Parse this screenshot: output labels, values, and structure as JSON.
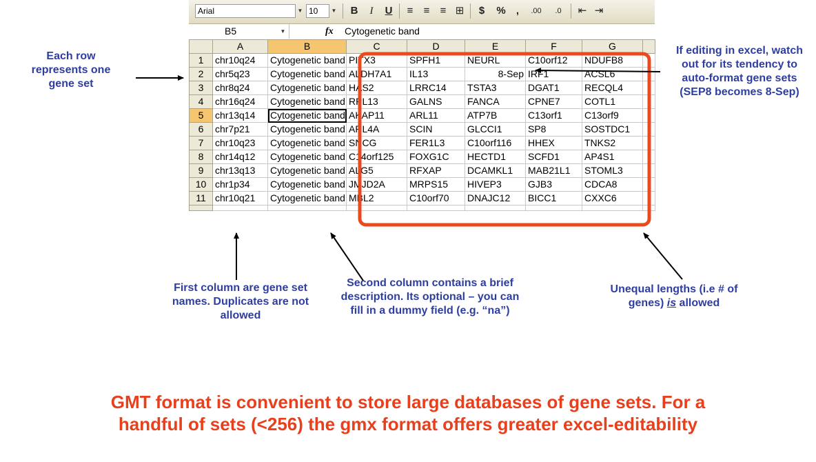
{
  "toolbar": {
    "font_name": "Arial",
    "font_size": "10",
    "bold": "B",
    "italic": "I",
    "underline": "U",
    "currency": "$",
    "percent": "%",
    "comma": ",",
    "inc_decimal": ".00",
    "dec_decimal": ".0"
  },
  "formula_bar": {
    "name_box": "B5",
    "fx": "fx",
    "content": "Cytogenetic band"
  },
  "grid": {
    "columns": [
      "A",
      "B",
      "C",
      "D",
      "E",
      "F",
      "G"
    ],
    "rows": [
      {
        "n": "1",
        "cells": [
          "chr10q24",
          "Cytogenetic band",
          "PITX3",
          "SPFH1",
          "NEURL",
          "C10orf12",
          "NDUFB8"
        ]
      },
      {
        "n": "2",
        "cells": [
          "chr5q23",
          "Cytogenetic band",
          "ALDH7A1",
          "IL13",
          "8-Sep",
          "IRF1",
          "ACSL6"
        ]
      },
      {
        "n": "3",
        "cells": [
          "chr8q24",
          "Cytogenetic band",
          "HAS2",
          "LRRC14",
          "TSTA3",
          "DGAT1",
          "RECQL4"
        ]
      },
      {
        "n": "4",
        "cells": [
          "chr16q24",
          "Cytogenetic band",
          "RPL13",
          "GALNS",
          "FANCA",
          "CPNE7",
          "COTL1"
        ]
      },
      {
        "n": "5",
        "cells": [
          "chr13q14",
          "Cytogenetic band",
          "AKAP11",
          "ARL11",
          "ATP7B",
          "C13orf1",
          "C13orf9"
        ]
      },
      {
        "n": "6",
        "cells": [
          "chr7p21",
          "Cytogenetic band",
          "ARL4A",
          "SCIN",
          "GLCCI1",
          "SP8",
          "SOSTDC1"
        ]
      },
      {
        "n": "7",
        "cells": [
          "chr10q23",
          "Cytogenetic band",
          "SNCG",
          "FER1L3",
          "C10orf116",
          "HHEX",
          "TNKS2"
        ]
      },
      {
        "n": "8",
        "cells": [
          "chr14q12",
          "Cytogenetic band",
          "C14orf125",
          "FOXG1C",
          "HECTD1",
          "SCFD1",
          "AP4S1"
        ]
      },
      {
        "n": "9",
        "cells": [
          "chr13q13",
          "Cytogenetic band",
          "ALG5",
          "RFXAP",
          "DCAMKL1",
          "MAB21L1",
          "STOML3"
        ]
      },
      {
        "n": "10",
        "cells": [
          "chr1p34",
          "Cytogenetic band",
          "JMJD2A",
          "MRPS15",
          "HIVEP3",
          "GJB3",
          "CDCA8"
        ]
      },
      {
        "n": "11",
        "cells": [
          "chr10q21",
          "Cytogenetic band",
          "MBL2",
          "C10orf70",
          "DNAJC12",
          "BICC1",
          "CXXC6"
        ]
      }
    ]
  },
  "annotations": {
    "row_note": "Each row represents one gene set",
    "excel_note": "If editing in excel, watch out for its tendency to auto-format gene sets (SEP8 becomes 8-Sep)",
    "first_col_note": "First column are gene set names. Duplicates are not allowed",
    "second_col_note": "Second column contains a brief description. Its optional – you can fill in a dummy field (e.g. “na”)",
    "unequal_note_a": "Unequal lengths (i.e # of genes) ",
    "unequal_note_is": "is",
    "unequal_note_b": " allowed",
    "bottom_note": "GMT format is convenient to store large databases of gene sets. For a handful of sets (<256) the gmx format offers greater excel-editability"
  },
  "colors": {
    "note_blue": "#2e3ea0",
    "highlight_red": "#e8401c",
    "selected_header": "#f6c56f"
  }
}
